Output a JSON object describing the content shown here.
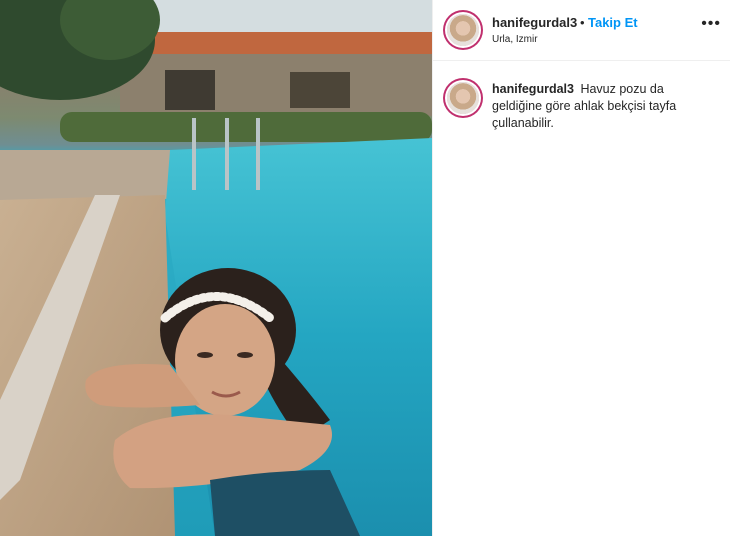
{
  "post": {
    "username": "hanifegurdal3",
    "separator": "•",
    "follow_label": "Takip Et",
    "location": "Urla, Izmir",
    "more_icon": "more-options-icon",
    "caption": "Havuz pozu da geldiğine göre ahlak bekçisi tayfa çullanabilir."
  },
  "colors": {
    "follow_blue": "#0095f6",
    "story_ring": "#c0306e",
    "pool_water": "#29a8c3"
  }
}
